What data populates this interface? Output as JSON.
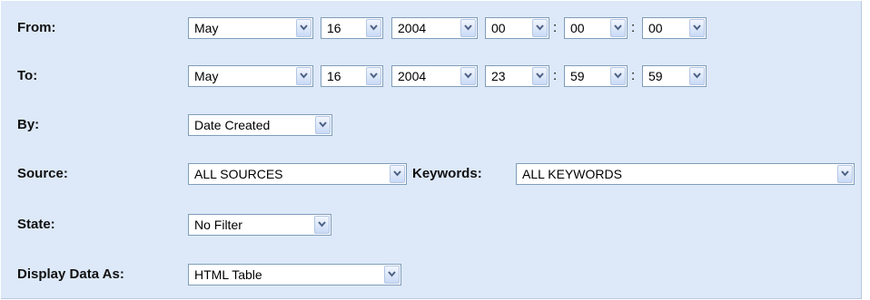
{
  "form": {
    "from": {
      "label": "From:",
      "month": "May",
      "day": "16",
      "year": "2004",
      "hour": "00",
      "minute": "00",
      "second": "00"
    },
    "to": {
      "label": "To:",
      "month": "May",
      "day": "16",
      "year": "2004",
      "hour": "23",
      "minute": "59",
      "second": "59"
    },
    "time_separator": ":",
    "by": {
      "label": "By:",
      "value": "Date Created"
    },
    "source": {
      "label": "Source:",
      "value": "ALL SOURCES"
    },
    "keywords": {
      "label": "Keywords:",
      "value": "ALL KEYWORDS"
    },
    "state": {
      "label": "State:",
      "value": "No Filter"
    },
    "display": {
      "label": "Display Data As:",
      "value": "HTML Table"
    }
  },
  "theme": {
    "panel_background": "#dde9f8",
    "select_border": "#7f9db9",
    "arrow_color": "#4d6185"
  },
  "icons": {
    "dropdown": "chevron-down-icon"
  }
}
